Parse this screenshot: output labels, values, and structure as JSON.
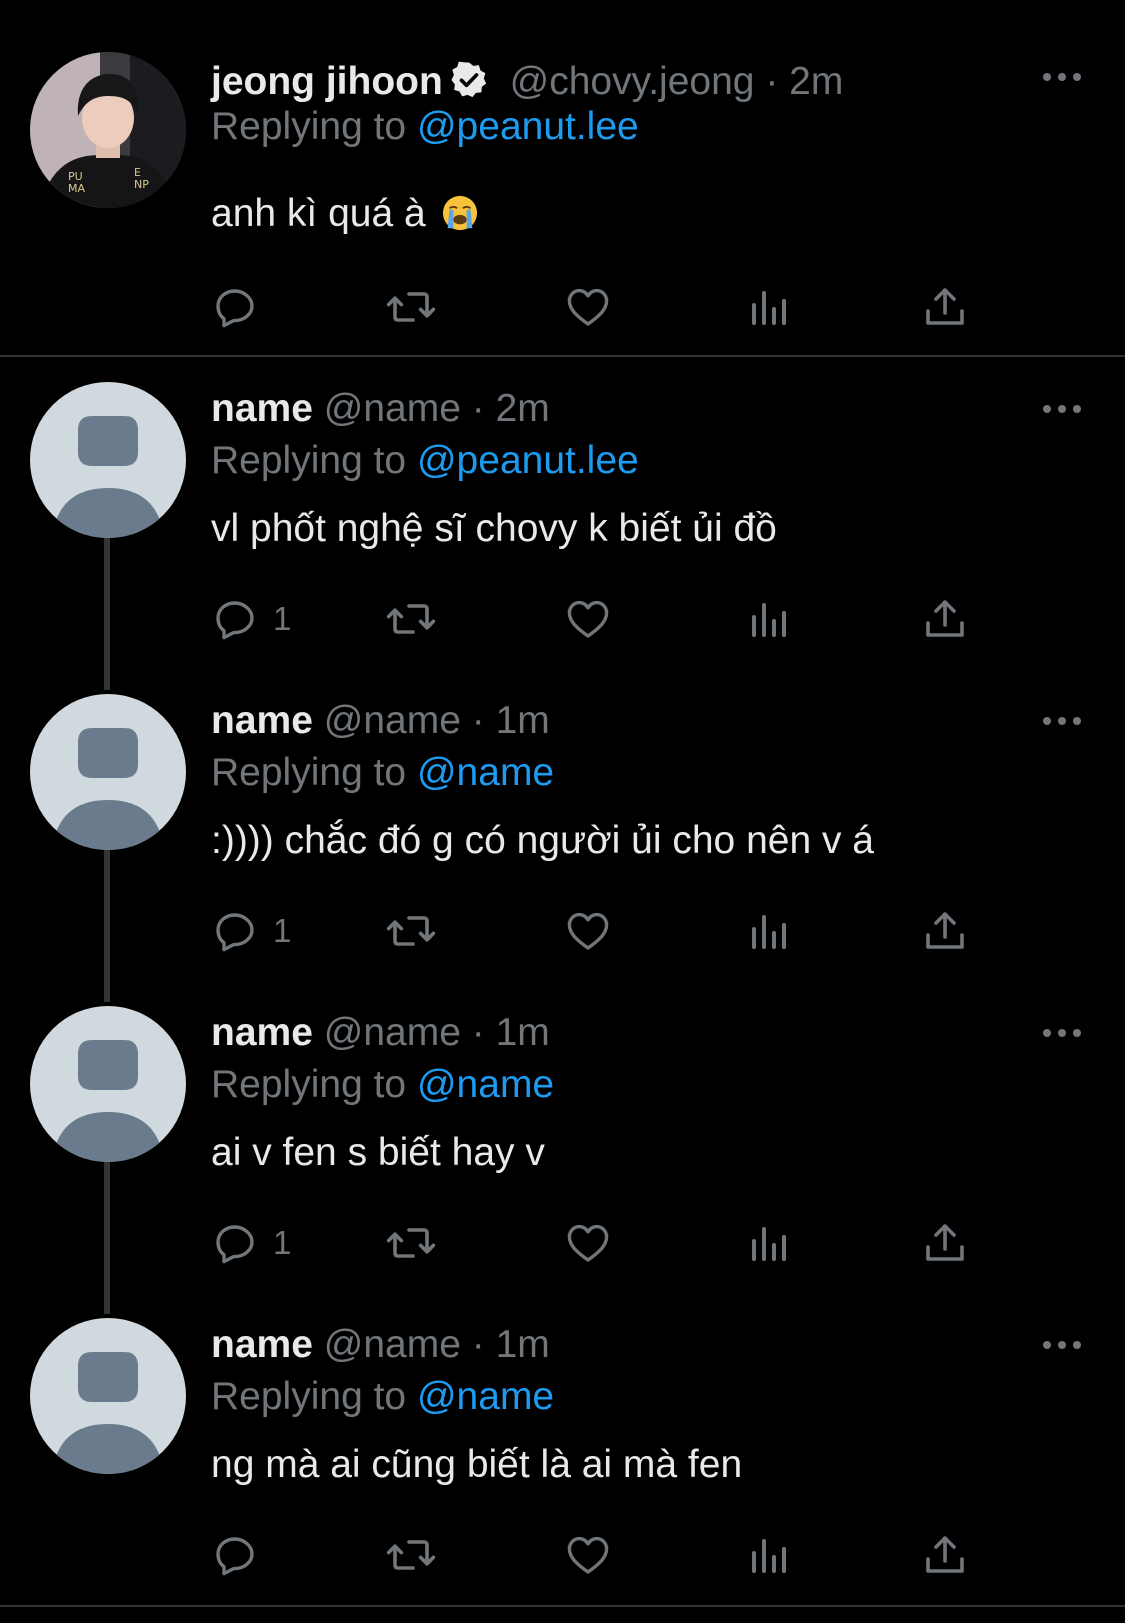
{
  "colors": {
    "background": "#000000",
    "text": "#e7e9ea",
    "muted": "#71767b",
    "mention": "#1d9bf0",
    "thread_line": "#333639",
    "default_avatar_bg": "#cfd9de",
    "default_avatar_fg": "#697b8c"
  },
  "tweets": [
    {
      "display_name": "jeong jihoon",
      "verified": true,
      "handle": "@chovy.jeong",
      "separator": "·",
      "time": "2m",
      "replying_prefix": "Replying to",
      "replying_to": "@peanut.lee",
      "text": "anh kì quá à",
      "emoji": "loudly-crying-face-emoji",
      "avatar": "profile-photo",
      "reply_count": ""
    },
    {
      "display_name": "name",
      "verified": false,
      "handle": "@name",
      "separator": "·",
      "time": "2m",
      "replying_prefix": "Replying to",
      "replying_to": "@peanut.lee",
      "text": "vl phốt nghệ sĩ chovy k biết ủi đồ",
      "avatar": "default-avatar",
      "reply_count": "1"
    },
    {
      "display_name": "name",
      "verified": false,
      "handle": "@name",
      "separator": "·",
      "time": "1m",
      "replying_prefix": "Replying to",
      "replying_to": "@name",
      "text": ":)))) chắc đó g có người ủi cho nên v á",
      "avatar": "default-avatar",
      "reply_count": "1"
    },
    {
      "display_name": "name",
      "verified": false,
      "handle": "@name",
      "separator": "·",
      "time": "1m",
      "replying_prefix": "Replying to",
      "replying_to": "@name",
      "text": "ai v fen s biết hay v",
      "avatar": "default-avatar",
      "reply_count": "1"
    },
    {
      "display_name": "name",
      "verified": false,
      "handle": "@name",
      "separator": "·",
      "time": "1m",
      "replying_prefix": "Replying to",
      "replying_to": "@name",
      "text": "ng mà ai cũng biết là ai mà fen",
      "avatar": "default-avatar",
      "reply_count": ""
    }
  ],
  "icons": {
    "reply": "reply-icon",
    "retweet": "retweet-icon",
    "like": "heart-icon",
    "views": "views-chart-icon",
    "share": "share-icon",
    "more": "more-options-icon",
    "verified": "verified-badge-icon"
  }
}
